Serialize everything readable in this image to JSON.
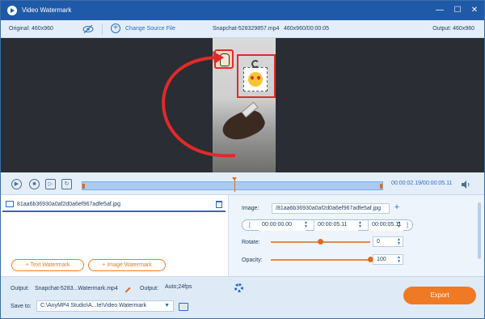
{
  "window": {
    "title": "Video Watermark",
    "controls": [
      "—",
      "☐",
      "✕"
    ]
  },
  "info_bar": {
    "original": "Original: 460x960",
    "change_source": "Change Source File",
    "file_name": "Snapchat-528329857.mp4",
    "file_meta": "460x960/00:00:05",
    "output": "Output: 460x960"
  },
  "playback": {
    "time": "00:00:02.19/00:00:05.11"
  },
  "watermark_list": {
    "items": [
      {
        "name": "81aa6b36930a0af2d0a6ef967adfe5af.jpg"
      }
    ],
    "text_watermark": "Text Watermark",
    "image_watermark": "Image Watermark"
  },
  "settings": {
    "image_label": "Image:",
    "image_value": "/81aa6b36930a0af2d0a6ef967adfe5af.jpg",
    "start_time": "00:00:00.00",
    "end_time": "00:00:05.11",
    "end_time2": "00:00:05.11",
    "rotate_label": "Rotate:",
    "rotate_value": "0",
    "rotate_level": 0.5,
    "opacity_label": "Opacity:",
    "opacity_value": "100",
    "opacity_level": 1.0
  },
  "bottom": {
    "output_label": "Output:",
    "output_file": "Snapchat-5283...Watermark.mp4",
    "output_format_label": "Output:",
    "output_format": "Auto;24fps",
    "save_label": "Save to:",
    "save_path": "C:\\AnyMP4 Studio\\A...te\\Video Watermark",
    "export": "Export"
  },
  "colors": {
    "accent": "#2b6cc4",
    "orange": "#f07a24",
    "title_bar": "#1f5aa8"
  }
}
